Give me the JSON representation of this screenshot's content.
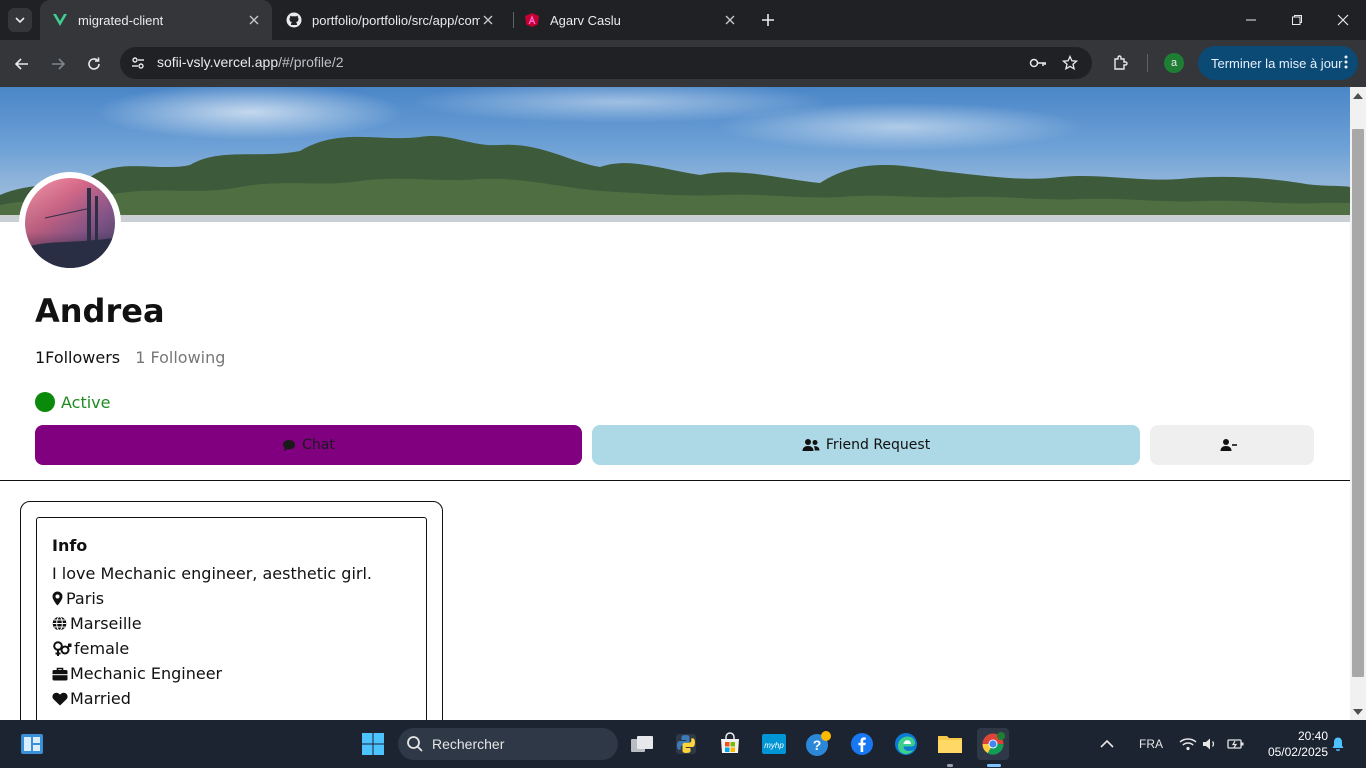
{
  "browser": {
    "tabs": [
      {
        "title": "migrated-client",
        "icon": "vercel-v-icon",
        "active": true
      },
      {
        "title": "portfolio/portfolio/src/app/com",
        "icon": "github-icon",
        "active": false
      },
      {
        "title": "Agarv Caslu",
        "icon": "angular-icon",
        "active": false
      }
    ],
    "url_host": "sofii-vsly.vercel.app",
    "url_path": "/#/profile/2",
    "profile_initial": "a",
    "update_button_label": "Terminer la mise à jour"
  },
  "profile": {
    "name": "Andrea",
    "followers_text": "1Followers",
    "following_text": "1 Following",
    "status_text": "Active",
    "status_color": "#0a8a0a",
    "buttons": {
      "chat_label": "Chat",
      "friend_request_label": "Friend Request",
      "remove_label": ""
    },
    "accent_colors": {
      "chat": "#800080",
      "friend": "#add8e6",
      "remove": "#efefef"
    }
  },
  "info": {
    "title": "Info",
    "bio": "I love Mechanic engineer, aesthetic girl.",
    "location": "Paris",
    "hometown": "Marseille",
    "gender": "female",
    "job": "Mechanic Engineer",
    "relationship": "Married"
  },
  "taskbar": {
    "search_placeholder": "Rechercher",
    "language": "FRA",
    "time": "20:40",
    "date": "05/02/2025"
  }
}
